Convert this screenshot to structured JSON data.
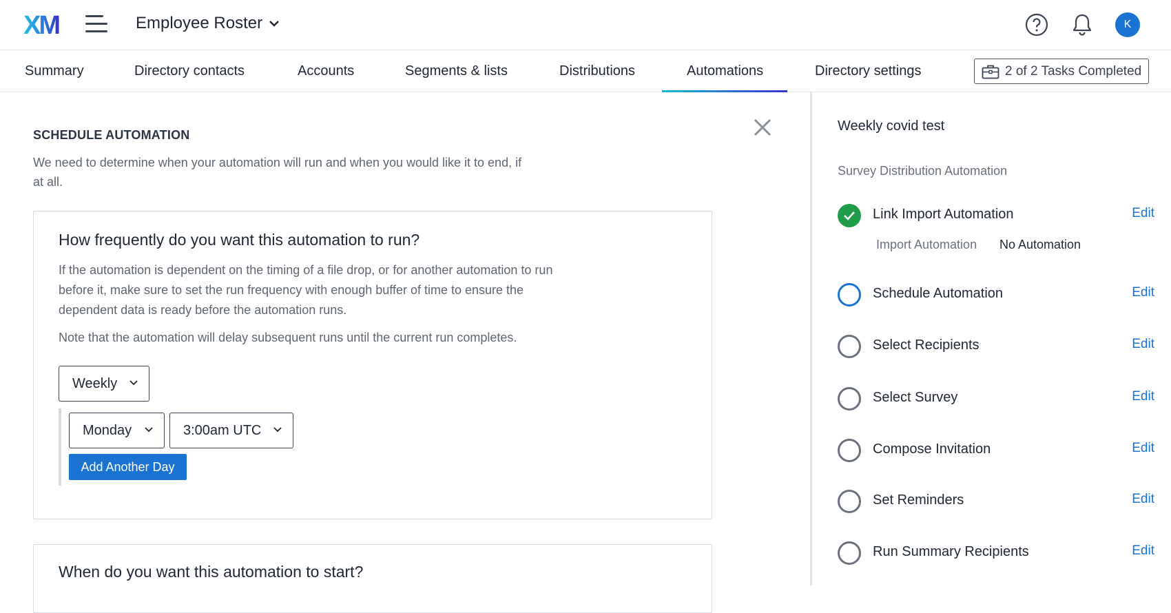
{
  "header": {
    "logo_text": "XM",
    "project_title": "Employee Roster",
    "avatar_initial": "K",
    "icons": [
      "menu-icon",
      "chevron-down-icon",
      "help-icon",
      "bell-icon"
    ]
  },
  "tabs": [
    {
      "label": "Summary",
      "active": false
    },
    {
      "label": "Directory contacts",
      "active": false
    },
    {
      "label": "Accounts",
      "active": false
    },
    {
      "label": "Segments & lists",
      "active": false
    },
    {
      "label": "Distributions",
      "active": false
    },
    {
      "label": "Automations",
      "active": true
    },
    {
      "label": "Directory settings",
      "active": false
    }
  ],
  "tasks_button": {
    "label": "2 of 2 Tasks Completed",
    "icon": "briefcase-icon"
  },
  "main": {
    "title": "SCHEDULE AUTOMATION",
    "description": "We need to determine when your automation will run and when you would like it to end, if at all.",
    "frequency_card": {
      "heading": "How frequently do you want this automation to run?",
      "paragraph1": "If the automation is dependent on the timing of a file drop, or for another automation to run before it, make sure to set the run frequency with enough buffer of time to ensure the dependent data is ready before the automation runs.",
      "paragraph2": "Note that the automation will delay subsequent runs until the current run completes.",
      "frequency_value": "Weekly",
      "day_value": "Monday",
      "time_value": "3:00am UTC",
      "add_day_label": "Add Another Day"
    },
    "start_card": {
      "heading": "When do you want this automation to start?"
    }
  },
  "side": {
    "title": "Weekly covid test",
    "subtitle": "Survey Distribution Automation",
    "edit_label": "Edit",
    "steps": [
      {
        "label": "Link Import Automation",
        "status": "done"
      },
      {
        "label": "Schedule Automation",
        "status": "current"
      },
      {
        "label": "Select Recipients",
        "status": "pending"
      },
      {
        "label": "Select Survey",
        "status": "pending"
      },
      {
        "label": "Compose Invitation",
        "status": "pending"
      },
      {
        "label": "Set Reminders",
        "status": "pending"
      },
      {
        "label": "Run Summary Recipients",
        "status": "pending"
      }
    ],
    "import_detail": {
      "label": "Import Automation",
      "value": "No Automation"
    }
  },
  "colors": {
    "accent_blue": "#1a73d1",
    "success_green": "#1f9c4a",
    "tab_gradient_start": "#14b9d4",
    "tab_gradient_end": "#3d35c9"
  }
}
